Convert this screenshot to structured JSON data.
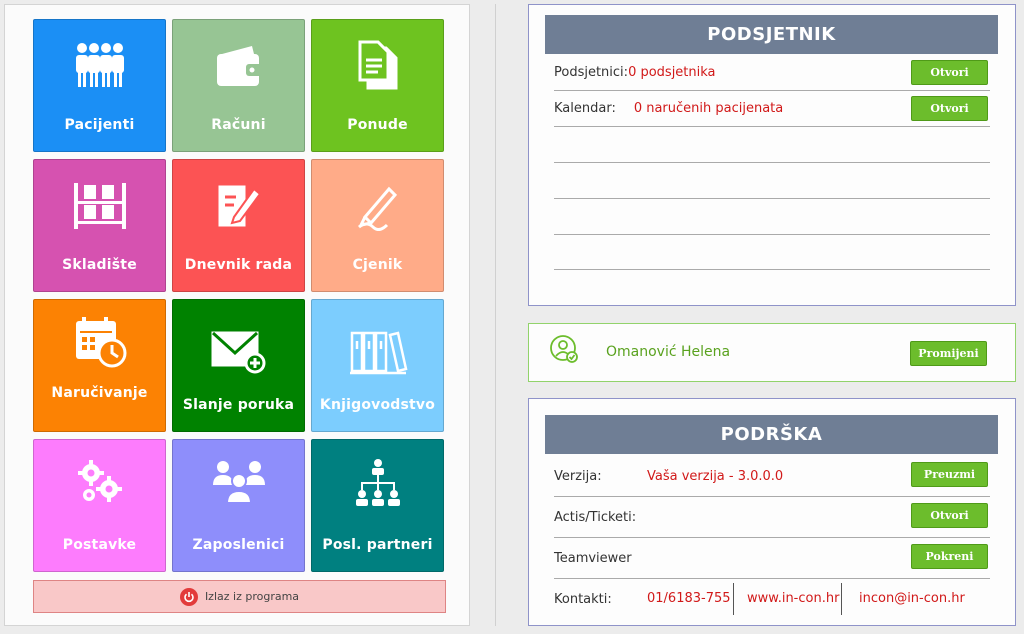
{
  "tiles": [
    {
      "label": "Pacijenti",
      "color": "#1b8ff5",
      "icon": "patients-icon"
    },
    {
      "label": "Računi",
      "color": "#97c594",
      "icon": "wallet-icon"
    },
    {
      "label": "Ponude",
      "color": "#6ec320",
      "icon": "documents-icon"
    },
    {
      "label": "Skladište",
      "color": "#d652b0",
      "icon": "shelf-icon"
    },
    {
      "label": "Dnevnik rada",
      "color": "#fc5354",
      "icon": "edit-document-icon"
    },
    {
      "label": "Cjenik",
      "color": "#ffab88",
      "icon": "pen-icon"
    },
    {
      "label": "Naručivanje",
      "color": "#fc8203",
      "icon": "calendar-clock-icon"
    },
    {
      "label": "Slanje poruka",
      "color": "#008200",
      "icon": "mail-plus-icon"
    },
    {
      "label": "Knjigovodstvo",
      "color": "#7ccdfe",
      "icon": "binders-icon"
    },
    {
      "label": "Postavke",
      "color": "#fd7cfd",
      "icon": "gears-icon"
    },
    {
      "label": "Zaposlenici",
      "color": "#8e8efb",
      "icon": "employees-icon"
    },
    {
      "label": "Posl. partneri",
      "color": "#008080",
      "icon": "org-chart-icon"
    }
  ],
  "exit": {
    "label": "Izlaz iz programa"
  },
  "reminder": {
    "title": "PODSJETNIK",
    "rows": [
      {
        "label": "Podsjetnici:",
        "value": "0 podsjetnika",
        "button": "Otvori"
      },
      {
        "label": "Kalendar:",
        "value": "0 naručenih pacijenata",
        "button": "Otvori"
      }
    ]
  },
  "user": {
    "name": "Omanović Helena",
    "button": "Promijeni"
  },
  "support": {
    "title": "PODRŠKA",
    "version": {
      "label": "Verzija:",
      "value": "Vaša verzija - 3.0.0.0",
      "button": "Preuzmi"
    },
    "tickets": {
      "label": "Actis/Ticketi:",
      "button": "Otvori"
    },
    "teamviewer": {
      "label": "Teamviewer",
      "button": "Pokreni"
    },
    "contacts": {
      "label": "Kontakti:",
      "phone": "01/6183-755",
      "web": "www.in-con.hr",
      "email": "incon@in-con.hr"
    }
  },
  "colors": {
    "header": "#6f7e95",
    "button": "#6cbd2c",
    "alert": "#d11919"
  }
}
